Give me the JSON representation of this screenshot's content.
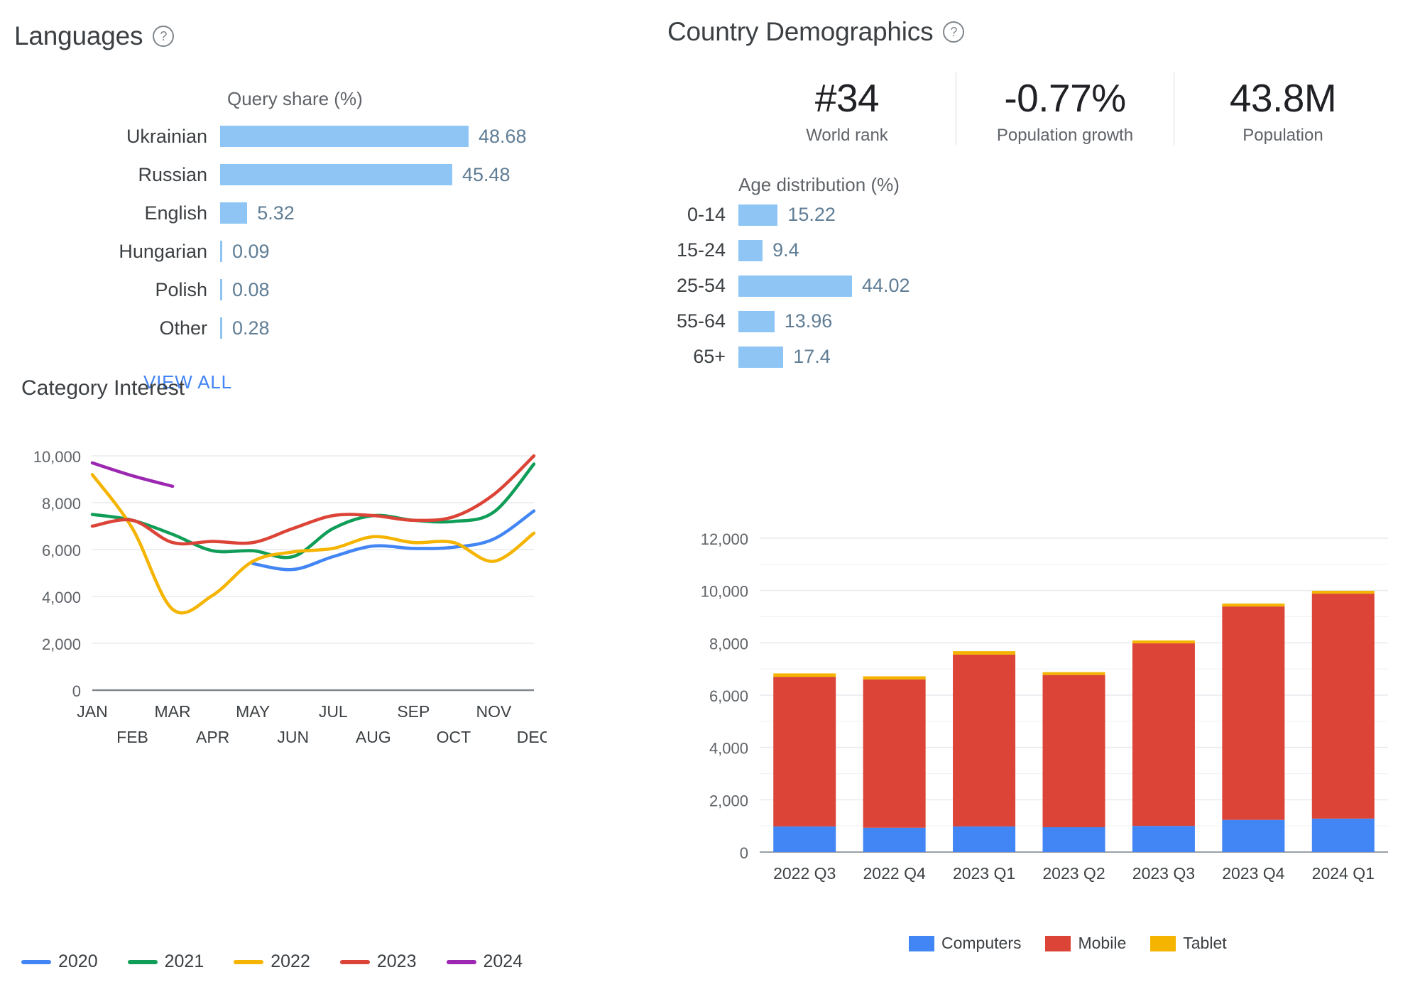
{
  "languages": {
    "title": "Languages",
    "help_icon": "help-circle-icon",
    "caption": "Query share (%)",
    "view_all_label": "VIEW ALL",
    "bar_color": "#8ec5f5",
    "value_color": "#5f7d95",
    "rows": [
      {
        "label": "Ukrainian",
        "value": "48.68",
        "num": 48.68
      },
      {
        "label": "Russian",
        "value": "45.48",
        "num": 45.48
      },
      {
        "label": "English",
        "value": "5.32",
        "num": 5.32
      },
      {
        "label": "Hungarian",
        "value": "0.09",
        "num": 0.09
      },
      {
        "label": "Polish",
        "value": "0.08",
        "num": 0.08
      },
      {
        "label": "Other",
        "value": "0.28",
        "num": 0.28
      }
    ]
  },
  "demographics": {
    "title": "Country Demographics",
    "help_icon": "help-circle-icon",
    "stats": [
      {
        "value": "#34",
        "label": "World rank"
      },
      {
        "value": "-0.77%",
        "label": "Population growth"
      },
      {
        "value": "43.8M",
        "label": "Population"
      }
    ],
    "age_caption": "Age distribution (%)",
    "age_rows": [
      {
        "label": "0-14",
        "value": "15.22",
        "num": 15.22
      },
      {
        "label": "15-24",
        "value": "9.4",
        "num": 9.4
      },
      {
        "label": "25-54",
        "value": "44.02",
        "num": 44.02
      },
      {
        "label": "55-64",
        "value": "13.96",
        "num": 13.96
      },
      {
        "label": "65+",
        "value": "17.4",
        "num": 17.4
      }
    ]
  },
  "category_interest": {
    "title": "Category Interest"
  },
  "chart_data": [
    {
      "type": "line",
      "title": "Category Interest",
      "xlabel": "",
      "ylabel": "",
      "ylim": [
        0,
        10000
      ],
      "yticks": [
        "0",
        "2,000",
        "4,000",
        "6,000",
        "8,000",
        "10,000"
      ],
      "grid": true,
      "legend_position": "bottom",
      "categories": [
        "JAN",
        "FEB",
        "MAR",
        "APR",
        "MAY",
        "JUN",
        "JUL",
        "AUG",
        "SEP",
        "OCT",
        "NOV",
        "DEC"
      ],
      "series": [
        {
          "name": "2020",
          "color": "#4285f4",
          "values": [
            null,
            null,
            null,
            null,
            5400,
            5150,
            5700,
            6150,
            6050,
            6100,
            6450,
            7650
          ]
        },
        {
          "name": "2021",
          "color": "#0f9d58",
          "values": [
            7500,
            7250,
            6650,
            5950,
            5950,
            5700,
            6900,
            7450,
            7250,
            7200,
            7600,
            9650
          ]
        },
        {
          "name": "2022",
          "color": "#f4b400",
          "values": [
            9200,
            6900,
            3450,
            4050,
            5500,
            5900,
            6050,
            6550,
            6300,
            6300,
            5500,
            6700
          ]
        },
        {
          "name": "2023",
          "color": "#db4437",
          "values": [
            7000,
            7250,
            6300,
            6350,
            6300,
            6900,
            7450,
            7450,
            7250,
            7400,
            8350,
            10000
          ]
        },
        {
          "name": "2024",
          "color": "#9c27b0",
          "values": [
            9700,
            9150,
            8700,
            null,
            null,
            null,
            null,
            null,
            null,
            null,
            null,
            null
          ]
        }
      ]
    },
    {
      "type": "bar",
      "stacked": true,
      "title": "",
      "xlabel": "",
      "ylabel": "",
      "ylim": [
        0,
        12000
      ],
      "yticks": [
        "0",
        "2,000",
        "4,000",
        "6,000",
        "8,000",
        "10,000",
        "12,000"
      ],
      "grid": true,
      "legend_position": "bottom",
      "categories": [
        "2022 Q3",
        "2022 Q4",
        "2023 Q1",
        "2023 Q2",
        "2023 Q3",
        "2023 Q4",
        "2024 Q1"
      ],
      "series": [
        {
          "name": "Computers",
          "color": "#4285f4",
          "values": [
            980,
            930,
            980,
            950,
            1000,
            1230,
            1280
          ]
        },
        {
          "name": "Mobile",
          "color": "#db4437",
          "values": [
            5720,
            5670,
            6570,
            5820,
            6980,
            8160,
            8600
          ]
        },
        {
          "name": "Tablet",
          "color": "#f4b400",
          "values": [
            130,
            120,
            130,
            110,
            110,
            110,
            110
          ]
        }
      ]
    }
  ]
}
